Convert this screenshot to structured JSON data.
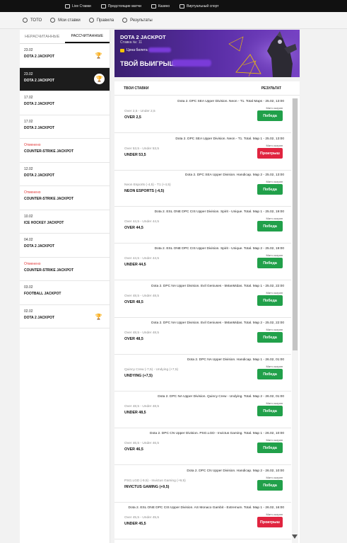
{
  "topnav": [
    {
      "label": "Live Ставки",
      "icon": "live-icon"
    },
    {
      "label": "Предстоящие матчи",
      "icon": "calendar-icon"
    },
    {
      "label": "Казино",
      "icon": "casino-icon"
    },
    {
      "label": "Виртуальный спорт",
      "icon": "virtual-sport-icon"
    }
  ],
  "subnav": [
    {
      "label": "ТОТО",
      "icon": "gear-icon"
    },
    {
      "label": "Мои ставки",
      "icon": "bets-icon"
    },
    {
      "label": "Правила",
      "icon": "book-icon"
    },
    {
      "label": "Результаты",
      "icon": "check-icon"
    }
  ],
  "sidebar": {
    "tabs": [
      {
        "label": "НЕРАСЧИТАННЫЕ",
        "active": false
      },
      {
        "label": "РАССЧИТАННЫЕ",
        "active": true
      }
    ],
    "items": [
      {
        "date": "23.02",
        "name": "DOTA 2 JACKPOT",
        "cancelled": false,
        "trophy": true,
        "selected": false
      },
      {
        "date": "23.02",
        "name": "DOTA 2 JACKPOT",
        "cancelled": false,
        "trophy": true,
        "selected": true
      },
      {
        "date": "17.02",
        "name": "DOTA 2 JACKPOT",
        "cancelled": false,
        "trophy": false,
        "selected": false
      },
      {
        "date": "17.02",
        "name": "DOTA 2 JACKPOT",
        "cancelled": false,
        "trophy": false,
        "selected": false
      },
      {
        "date": "Отменено",
        "name": "COUNTER-STRIKE JACKPOT",
        "cancelled": true,
        "trophy": false,
        "selected": false
      },
      {
        "date": "12.02",
        "name": "DOTA 2 JACKPOT",
        "cancelled": false,
        "trophy": false,
        "selected": false
      },
      {
        "date": "Отменено",
        "name": "COUNTER-STRIKE JACKPOT",
        "cancelled": true,
        "trophy": false,
        "selected": false
      },
      {
        "date": "10.02",
        "name": "ICE HOCKEY JACKPOT",
        "cancelled": false,
        "trophy": false,
        "selected": false
      },
      {
        "date": "04.02",
        "name": "DOTA 2 JACKPOT",
        "cancelled": false,
        "trophy": false,
        "selected": false
      },
      {
        "date": "Отменено",
        "name": "COUNTER-STRIKE JACKPOT",
        "cancelled": true,
        "trophy": false,
        "selected": false
      },
      {
        "date": "03.02",
        "name": "FOOTBALL JACKPOT",
        "cancelled": false,
        "trophy": false,
        "selected": false
      },
      {
        "date": "02.02",
        "name": "DOTA 2 JACKPOT",
        "cancelled": false,
        "trophy": true,
        "selected": false
      }
    ]
  },
  "banner": {
    "title": "DOTA 2 JACKPOT",
    "subtitle": "Ставка №: 11",
    "price_label": "Цена билета",
    "win_label": "ТВОЙ ВЫИГРЫШ"
  },
  "panel": {
    "col_bets": "ТВОИ СТАВКИ",
    "col_result": "РЕЗУЛЬТАТ",
    "bets": [
      {
        "event": "Dota 2. DPC SEA Upper Division. Neon - T1. Total Maps - 25.02, 13:00",
        "market": "Over 2,5 - Under 2,5",
        "choice": "OVER 2,5",
        "match_label": "Матч сыгран",
        "result": "Победа",
        "win": true
      },
      {
        "event": "Dota 2. DPC SEA Upper Division. Neon - T1. Total. Map 1 - 25.02, 13:00",
        "market": "Over 53,5 - Under 53,5",
        "choice": "UNDER 53,5",
        "match_label": "Матч сыгран",
        "result": "Проигрыш",
        "win": false
      },
      {
        "event": "Dota 2. DPC SEA Upper Division. Handicap. Map 2 - 25.02, 13:00",
        "market": "Neon Esports (-4,5) - T1 (+4,5)",
        "choice": "NEON ESPORTS (-4,5)",
        "match_label": "Матч сыгран",
        "result": "Победа",
        "win": true
      },
      {
        "event": "Dota 2. ESL ONE DPC CIS Upper Division. Spirit - Unique. Total. Map 1 - 25.02, 19:00",
        "market": "Over 44,5 - Under 44,5",
        "choice": "OVER 44,5",
        "match_label": "Матч сыгран",
        "result": "Победа",
        "win": true
      },
      {
        "event": "Dota 2. ESL ONE DPC CIS Upper Division. Spirit - Unique. Total. Map 2 - 25.02, 19:00",
        "market": "Over 44,5 - Under 44,5",
        "choice": "UNDER 44,5",
        "match_label": "Матч сыгран",
        "result": "Победа",
        "win": true
      },
      {
        "event": "Dota 2. DPC NA Upper Division. Evil Geniuses - 5ManMidas. Total. Map 1 - 25.02, 22:00",
        "market": "Over 48,5 - Under 48,5",
        "choice": "OVER 48,5",
        "match_label": "Матч сыгран",
        "result": "Победа",
        "win": true
      },
      {
        "event": "Dota 2. DPC NA Upper Division. Evil Geniuses - 5ManMidas. Total. Map 2 - 25.02, 22:00",
        "market": "Over 48,5 - Under 48,5",
        "choice": "OVER 48,5",
        "match_label": "Матч сыгран",
        "result": "Победа",
        "win": true
      },
      {
        "event": "Dota 2. DPC NA Upper Division. Handicap. Map 1 - 26.02, 01:00",
        "market": "Quincy Crew (-7,5) - Undying (+7,5)",
        "choice": "UNDYING (+7,5)",
        "match_label": "Матч сыгран",
        "result": "Победа",
        "win": true
      },
      {
        "event": "Dota 2. DPC NA Upper Division. Quincy Crew - Undying. Total. Map 2 - 26.02, 01:00",
        "market": "Over 48,5 - Under 48,5",
        "choice": "UNDER 48,5",
        "match_label": "Матч сыгран",
        "result": "Победа",
        "win": true
      },
      {
        "event": "Dota 2. DPC CN Upper Division. PSG.LGD - Invictus Gaming. Total. Map 1 - 26.02, 10:00",
        "market": "Over 46,5 - Under 46,5",
        "choice": "OVER 46,5",
        "match_label": "Матч сыгран",
        "result": "Победа",
        "win": true
      },
      {
        "event": "Dota 2. DPC CN Upper Division. Handicap. Map 2 - 26.02, 10:00",
        "market": "PSG.LGD (-9,5) - Invictus Gaming (+9,5)",
        "choice": "INVICTUS GAMING (+9,5)",
        "match_label": "Матч сыгран",
        "result": "Победа",
        "win": true
      },
      {
        "event": "Dota 2. ESL ONE DPC CIS Upper Division. AS Monaco Gambit - Extremum. Total. Map 1 - 26.02, 16:00",
        "market": "Over 45,5 - Under 45,5",
        "choice": "UNDER 45,5",
        "match_label": "Матч сыгран",
        "result": "Проигрыш",
        "win": false
      }
    ]
  },
  "colors": {
    "win": "#21a04a",
    "lose": "#e0243f",
    "banner_purple": "#5a2ea6",
    "cancelled": "#e33a3a"
  }
}
